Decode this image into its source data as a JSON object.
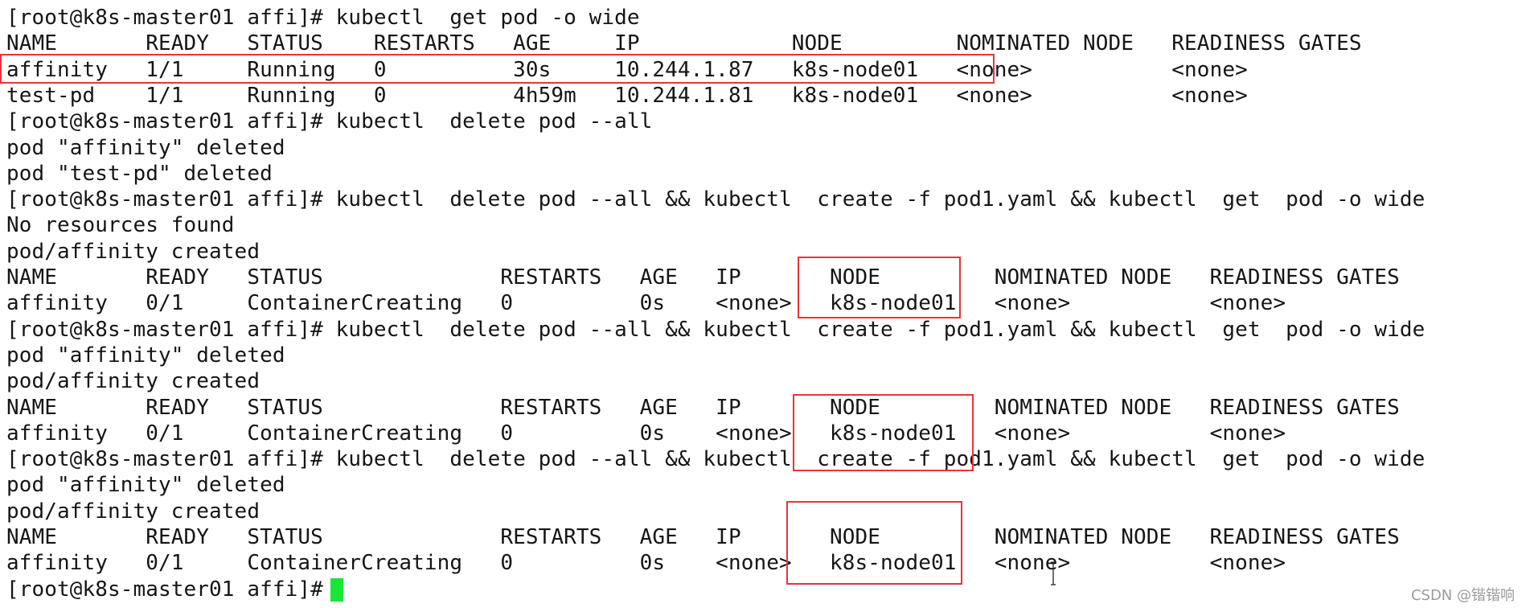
{
  "terminal": {
    "lines": [
      "[root@k8s-master01 affi]# kubectl  get pod -o wide",
      "NAME       READY   STATUS    RESTARTS   AGE     IP            NODE         NOMINATED NODE   READINESS GATES",
      "affinity   1/1     Running   0          30s     10.244.1.87   k8s-node01   <none>           <none>",
      "test-pd    1/1     Running   0          4h59m   10.244.1.81   k8s-node01   <none>           <none>",
      "[root@k8s-master01 affi]# kubectl  delete pod --all",
      "pod \"affinity\" deleted",
      "pod \"test-pd\" deleted",
      "[root@k8s-master01 affi]# kubectl  delete pod --all && kubectl  create -f pod1.yaml && kubectl  get  pod -o wide",
      "No resources found",
      "pod/affinity created",
      "NAME       READY   STATUS              RESTARTS   AGE   IP       NODE         NOMINATED NODE   READINESS GATES",
      "affinity   0/1     ContainerCreating   0          0s    <none>   k8s-node01   <none>           <none>",
      "[root@k8s-master01 affi]# kubectl  delete pod --all && kubectl  create -f pod1.yaml && kubectl  get  pod -o wide",
      "pod \"affinity\" deleted",
      "pod/affinity created",
      "NAME       READY   STATUS              RESTARTS   AGE   IP       NODE         NOMINATED NODE   READINESS GATES",
      "affinity   0/1     ContainerCreating   0          0s    <none>   k8s-node01   <none>           <none>",
      "[root@k8s-master01 affi]# kubectl  delete pod --all && kubectl  create -f pod1.yaml && kubectl  get  pod -o wide",
      "pod \"affinity\" deleted",
      "pod/affinity created",
      "NAME       READY   STATUS              RESTARTS   AGE   IP       NODE         NOMINATED NODE   READINESS GATES",
      "affinity   0/1     ContainerCreating   0          0s    <none>   k8s-node01   <none>           <none>",
      "[root@k8s-master01 affi]# "
    ]
  },
  "colors": {
    "highlight_box": "#e8343a",
    "cursor": "#19e63a",
    "background": "#ffffff",
    "text": "#151515"
  },
  "watermark": "CSDN @锴锴响"
}
